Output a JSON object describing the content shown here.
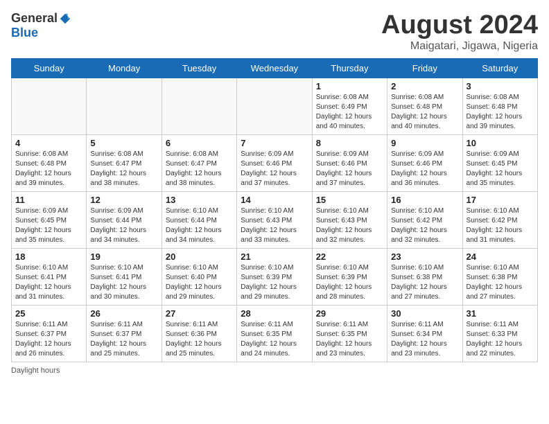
{
  "logo": {
    "general": "General",
    "blue": "Blue"
  },
  "title": "August 2024",
  "location": "Maigatari, Jigawa, Nigeria",
  "days_of_week": [
    "Sunday",
    "Monday",
    "Tuesday",
    "Wednesday",
    "Thursday",
    "Friday",
    "Saturday"
  ],
  "footer": "Daylight hours",
  "weeks": [
    [
      {
        "day": "",
        "info": ""
      },
      {
        "day": "",
        "info": ""
      },
      {
        "day": "",
        "info": ""
      },
      {
        "day": "",
        "info": ""
      },
      {
        "day": "1",
        "info": "Sunrise: 6:08 AM\nSunset: 6:49 PM\nDaylight: 12 hours and 40 minutes."
      },
      {
        "day": "2",
        "info": "Sunrise: 6:08 AM\nSunset: 6:48 PM\nDaylight: 12 hours and 40 minutes."
      },
      {
        "day": "3",
        "info": "Sunrise: 6:08 AM\nSunset: 6:48 PM\nDaylight: 12 hours and 39 minutes."
      }
    ],
    [
      {
        "day": "4",
        "info": "Sunrise: 6:08 AM\nSunset: 6:48 PM\nDaylight: 12 hours and 39 minutes."
      },
      {
        "day": "5",
        "info": "Sunrise: 6:08 AM\nSunset: 6:47 PM\nDaylight: 12 hours and 38 minutes."
      },
      {
        "day": "6",
        "info": "Sunrise: 6:08 AM\nSunset: 6:47 PM\nDaylight: 12 hours and 38 minutes."
      },
      {
        "day": "7",
        "info": "Sunrise: 6:09 AM\nSunset: 6:46 PM\nDaylight: 12 hours and 37 minutes."
      },
      {
        "day": "8",
        "info": "Sunrise: 6:09 AM\nSunset: 6:46 PM\nDaylight: 12 hours and 37 minutes."
      },
      {
        "day": "9",
        "info": "Sunrise: 6:09 AM\nSunset: 6:46 PM\nDaylight: 12 hours and 36 minutes."
      },
      {
        "day": "10",
        "info": "Sunrise: 6:09 AM\nSunset: 6:45 PM\nDaylight: 12 hours and 35 minutes."
      }
    ],
    [
      {
        "day": "11",
        "info": "Sunrise: 6:09 AM\nSunset: 6:45 PM\nDaylight: 12 hours and 35 minutes."
      },
      {
        "day": "12",
        "info": "Sunrise: 6:09 AM\nSunset: 6:44 PM\nDaylight: 12 hours and 34 minutes."
      },
      {
        "day": "13",
        "info": "Sunrise: 6:10 AM\nSunset: 6:44 PM\nDaylight: 12 hours and 34 minutes."
      },
      {
        "day": "14",
        "info": "Sunrise: 6:10 AM\nSunset: 6:43 PM\nDaylight: 12 hours and 33 minutes."
      },
      {
        "day": "15",
        "info": "Sunrise: 6:10 AM\nSunset: 6:43 PM\nDaylight: 12 hours and 32 minutes."
      },
      {
        "day": "16",
        "info": "Sunrise: 6:10 AM\nSunset: 6:42 PM\nDaylight: 12 hours and 32 minutes."
      },
      {
        "day": "17",
        "info": "Sunrise: 6:10 AM\nSunset: 6:42 PM\nDaylight: 12 hours and 31 minutes."
      }
    ],
    [
      {
        "day": "18",
        "info": "Sunrise: 6:10 AM\nSunset: 6:41 PM\nDaylight: 12 hours and 31 minutes."
      },
      {
        "day": "19",
        "info": "Sunrise: 6:10 AM\nSunset: 6:41 PM\nDaylight: 12 hours and 30 minutes."
      },
      {
        "day": "20",
        "info": "Sunrise: 6:10 AM\nSunset: 6:40 PM\nDaylight: 12 hours and 29 minutes."
      },
      {
        "day": "21",
        "info": "Sunrise: 6:10 AM\nSunset: 6:39 PM\nDaylight: 12 hours and 29 minutes."
      },
      {
        "day": "22",
        "info": "Sunrise: 6:10 AM\nSunset: 6:39 PM\nDaylight: 12 hours and 28 minutes."
      },
      {
        "day": "23",
        "info": "Sunrise: 6:10 AM\nSunset: 6:38 PM\nDaylight: 12 hours and 27 minutes."
      },
      {
        "day": "24",
        "info": "Sunrise: 6:10 AM\nSunset: 6:38 PM\nDaylight: 12 hours and 27 minutes."
      }
    ],
    [
      {
        "day": "25",
        "info": "Sunrise: 6:11 AM\nSunset: 6:37 PM\nDaylight: 12 hours and 26 minutes."
      },
      {
        "day": "26",
        "info": "Sunrise: 6:11 AM\nSunset: 6:37 PM\nDaylight: 12 hours and 25 minutes."
      },
      {
        "day": "27",
        "info": "Sunrise: 6:11 AM\nSunset: 6:36 PM\nDaylight: 12 hours and 25 minutes."
      },
      {
        "day": "28",
        "info": "Sunrise: 6:11 AM\nSunset: 6:35 PM\nDaylight: 12 hours and 24 minutes."
      },
      {
        "day": "29",
        "info": "Sunrise: 6:11 AM\nSunset: 6:35 PM\nDaylight: 12 hours and 23 minutes."
      },
      {
        "day": "30",
        "info": "Sunrise: 6:11 AM\nSunset: 6:34 PM\nDaylight: 12 hours and 23 minutes."
      },
      {
        "day": "31",
        "info": "Sunrise: 6:11 AM\nSunset: 6:33 PM\nDaylight: 12 hours and 22 minutes."
      }
    ]
  ]
}
